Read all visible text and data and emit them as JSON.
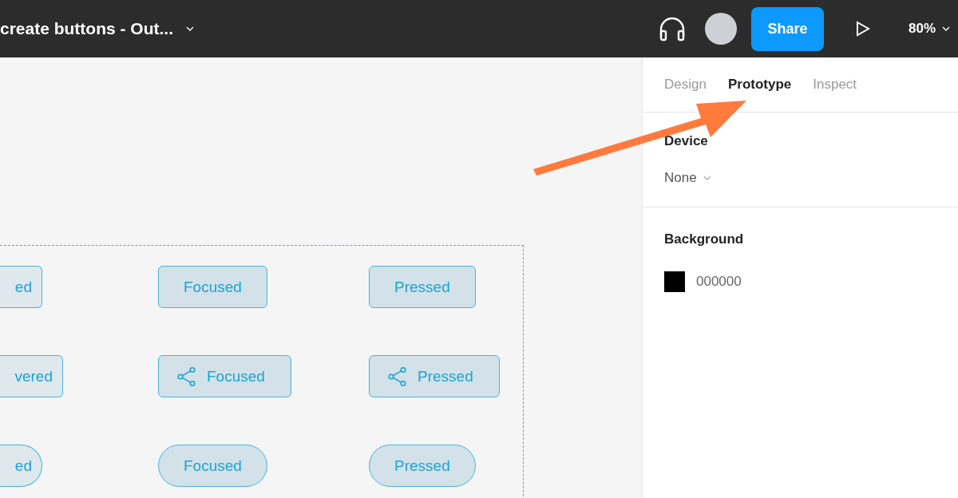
{
  "title_bar": {
    "file_name": "create buttons - Out...",
    "share_button": "Share",
    "zoom": "80%"
  },
  "canvas": {
    "button_rows": [
      {
        "kind": "rounded",
        "buttons": [
          "ed",
          "Focused",
          "Pressed"
        ]
      },
      {
        "kind": "icon",
        "buttons": [
          "vered",
          "Focused",
          "Pressed"
        ]
      },
      {
        "kind": "pill",
        "buttons": [
          "ed",
          "Focused",
          "Pressed"
        ]
      }
    ]
  },
  "panel": {
    "tabs": [
      {
        "label": "Design",
        "selected": false
      },
      {
        "label": "Prototype",
        "selected": true
      },
      {
        "label": "Inspect",
        "selected": false
      }
    ],
    "device": {
      "label": "Device",
      "value": "None"
    },
    "background": {
      "label": "Background",
      "hex": "000000"
    }
  }
}
